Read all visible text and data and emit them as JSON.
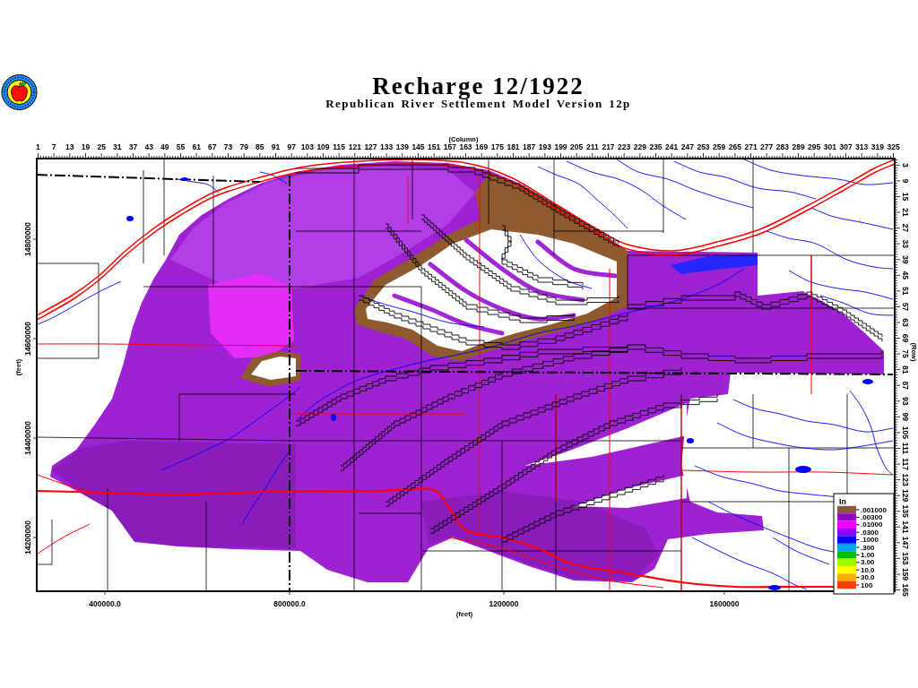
{
  "title": "Recharge 12/1922",
  "subtitle": "Republican River Settlement Model Version 12p",
  "map": {
    "column_axis": {
      "title": "(Column)",
      "ticks": [
        "1",
        "7",
        "13",
        "19",
        "25",
        "31",
        "37",
        "43",
        "49",
        "55",
        "61",
        "67",
        "73",
        "79",
        "85",
        "91",
        "97",
        "103",
        "109",
        "115",
        "121",
        "127",
        "133",
        "139",
        "145",
        "151",
        "157",
        "163",
        "169",
        "175",
        "181",
        "187",
        "193",
        "199",
        "205",
        "211",
        "217",
        "223",
        "229",
        "235",
        "241",
        "247",
        "253",
        "259",
        "265",
        "271",
        "277",
        "283",
        "289",
        "295",
        "301",
        "307",
        "313",
        "319",
        "325"
      ]
    },
    "row_axis": {
      "title": "(Row)",
      "ticks": [
        "3",
        "9",
        "15",
        "21",
        "27",
        "33",
        "39",
        "45",
        "51",
        "57",
        "63",
        "69",
        "75",
        "81",
        "87",
        "93",
        "99",
        "105",
        "111",
        "117",
        "123",
        "129",
        "135",
        "141",
        "147",
        "153",
        "159",
        "165"
      ]
    },
    "y_axis": {
      "title": "(feet)",
      "ticks": [
        "14800000",
        "14600000",
        "14400000",
        "14200000"
      ]
    },
    "x_axis": {
      "title": "(feet)",
      "ticks": [
        "400000.0",
        "800000.0",
        "1200000",
        "1600000"
      ]
    },
    "legend": {
      "title": "In",
      "stops": [
        {
          "label": ".001000",
          "color": "#8b5a46"
        },
        {
          "label": ".00300",
          "color": "#9a00c8"
        },
        {
          "label": ".01000",
          "color": "#f000ff"
        },
        {
          "label": ".0300",
          "color": "#8c00ff"
        },
        {
          "label": ".1000",
          "color": "#0000ff"
        },
        {
          "label": ".300",
          "color": "#00a8ff"
        },
        {
          "label": "1.00",
          "color": "#00c000"
        },
        {
          "label": "3.00",
          "color": "#98ff00"
        },
        {
          "label": "10.0",
          "color": "#ffff00"
        },
        {
          "label": "30.0",
          "color": "#ffac00"
        },
        {
          "label": "100",
          "color": "#ff4000"
        }
      ]
    }
  }
}
